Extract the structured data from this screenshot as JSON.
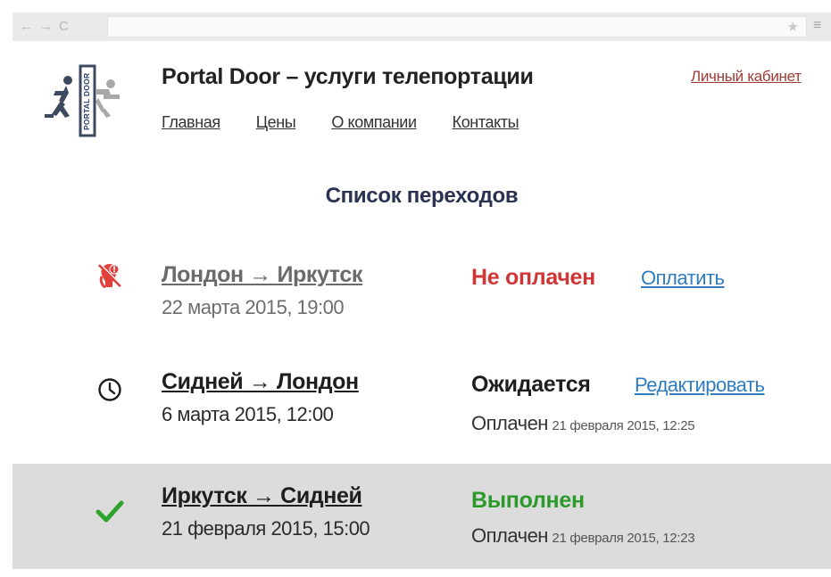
{
  "browser": {
    "back_icon": "←",
    "forward_icon": "→",
    "reload_icon": "C",
    "star_icon": "★",
    "menu_icon": "≡"
  },
  "header": {
    "logo_text": "PORTAL DOOR",
    "title": "Portal Door – услуги телепортации",
    "account_link": "Личный кабинет",
    "nav": [
      "Главная",
      "Цены",
      "О компании",
      "Контакты"
    ]
  },
  "main": {
    "section_title": "Список переходов",
    "transitions": [
      {
        "icon": "unpaid-icon",
        "route": "Лондон → Иркутск",
        "date": "22 марта 2015, 19:00",
        "status": "Не оплачен",
        "status_color": "#cf3535",
        "action": "Оплатить"
      },
      {
        "icon": "clock-icon",
        "route": "Сидней → Лондон",
        "date": "6 марта 2015, 12:00",
        "status": "Ожидается",
        "status_color": "#1e1e1e",
        "action": "Редактировать",
        "paid_label": "Оплачен",
        "paid_time": "21 февраля 2015, 12:25"
      },
      {
        "icon": "checkmark-icon",
        "route": "Иркутск → Сидней",
        "date": "21 февраля 2015, 15:00",
        "status": "Выполнен",
        "status_color": "#2b9a2b",
        "paid_label": "Оплачен",
        "paid_time": "21 февраля 2015, 12:23"
      }
    ]
  },
  "colors": {
    "link": "#2f7dc0",
    "account_link": "#a03a34",
    "title": "#2a3151",
    "highlight_row": "#dcdcdc"
  }
}
